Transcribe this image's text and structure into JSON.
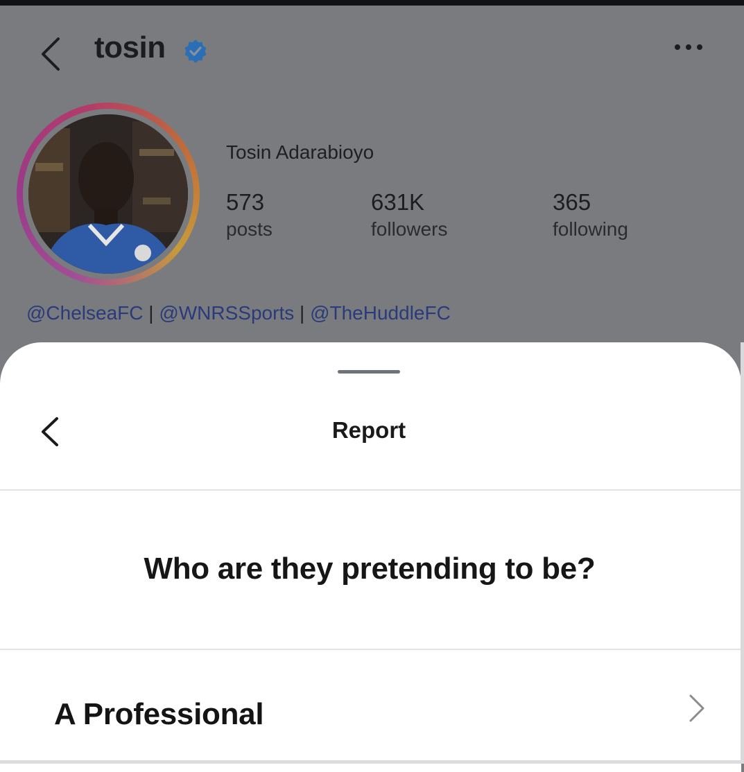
{
  "profile": {
    "username": "tosin",
    "full_name": "Tosin Adarabioyo",
    "stats": [
      {
        "value": "573",
        "label": "posts"
      },
      {
        "value": "631K",
        "label": "followers"
      },
      {
        "value": "365",
        "label": "following"
      }
    ],
    "bio": {
      "links": [
        "@ChelseaFC",
        "@WNRSSports",
        "@TheHuddleFC"
      ],
      "separator": "|"
    }
  },
  "icons": {
    "back": "chevron-left-icon",
    "verified": "verified-badge-icon",
    "more": "more-horizontal-icon",
    "option_arrow": "chevron-right-icon"
  },
  "sheet": {
    "title": "Report",
    "question": "Who are they pretending to be?",
    "options": [
      {
        "label": "A Professional"
      }
    ]
  },
  "colors": {
    "overlay_bg": "#797b7f",
    "verified_blue": "#2a6fb5",
    "link": "#2a3a7a",
    "sheet_bg": "#ffffff"
  }
}
